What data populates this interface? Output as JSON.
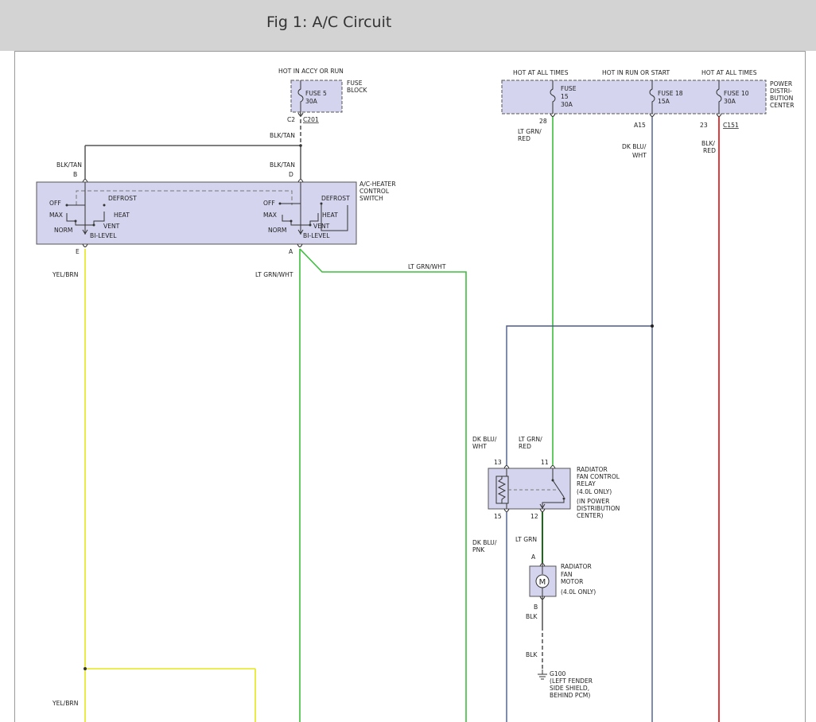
{
  "header": {
    "title": "Fig 1: A/C Circuit"
  },
  "fuse_block": {
    "hot_label": "HOT IN ACCY OR RUN",
    "fuse_name": "FUSE 5",
    "fuse_rating": "30A",
    "label_1": "FUSE",
    "label_2": "BLOCK",
    "conn_pin": "C2",
    "conn_name": "C201"
  },
  "pdc": {
    "hot1": "HOT AT ALL TIMES",
    "hot2": "HOT IN RUN OR START",
    "hot3": "HOT AT ALL TIMES",
    "fuse15_a": "FUSE",
    "fuse15_b": "15",
    "fuse15_c": "30A",
    "fuse18_a": "FUSE 18",
    "fuse18_b": "15A",
    "fuse10_a": "FUSE 10",
    "fuse10_b": "30A",
    "label_1": "POWER",
    "label_2": "DISTRI-",
    "label_3": "BUTION",
    "label_4": "CENTER",
    "pin28": "28",
    "pinA15": "A15",
    "pin23": "23",
    "conn": "C151"
  },
  "wires": {
    "blk_tan_top": "BLK/TAN",
    "blk_tan_b": "BLK/TAN",
    "blk_tan_d": "BLK/TAN",
    "yel_brn": "YEL/BRN",
    "lt_grn_wht_left": "LT GRN/WHT",
    "lt_grn_wht_right": "LT GRN/WHT",
    "lt_grn_red_1": "LT GRN/",
    "lt_grn_red_2": "RED",
    "dk_blu_wht_1": "DK BLU/",
    "dk_blu_wht_2": "WHT",
    "blk_red_1": "BLK/",
    "blk_red_2": "RED",
    "relay_left_1": "DK BLU/",
    "relay_left_2": "WHT",
    "relay_right_1": "LT GRN/",
    "relay_right_2": "RED",
    "dk_blu_pnk_1": "DK BLU/",
    "dk_blu_pnk_2": "PNK",
    "lt_grn": "LT GRN",
    "blk_1": "BLK",
    "blk_2": "BLK",
    "yel_brn_bottom": "YEL/BRN"
  },
  "switch": {
    "pin_b": "B",
    "pin_d": "D",
    "pin_e": "E",
    "pin_a": "A",
    "label_1": "A/C-HEATER",
    "label_2": "CONTROL",
    "label_3": "SWITCH",
    "off_l": "OFF",
    "defrost_l": "DEFROST",
    "max_l": "MAX",
    "heat_l": "HEAT",
    "norm_l": "NORM",
    "vent_l": "VENT",
    "bilevel_l": "BI-LEVEL",
    "off_r": "OFF",
    "defrost_r": "DEFROST",
    "max_r": "MAX",
    "heat_r": "HEAT",
    "norm_r": "NORM",
    "vent_r": "VENT",
    "bilevel_r": "BI-LEVEL"
  },
  "relay": {
    "pin13": "13",
    "pin11": "11",
    "pin15": "15",
    "pin12": "12",
    "label_1": "RADIATOR",
    "label_2": "FAN CONTROL",
    "label_3": "RELAY",
    "label_4": "(4.0L ONLY)",
    "label_5": "(IN POWER",
    "label_6": "DISTRIBUTION",
    "label_7": "CENTER)"
  },
  "motor": {
    "pin_a": "A",
    "pin_b": "B",
    "symbol": "M",
    "label_1": "RADIATOR",
    "label_2": "FAN",
    "label_3": "MOTOR",
    "label_4": "(4.0L ONLY)"
  },
  "ground": {
    "name": "G100",
    "label_1": "(LEFT FENDER",
    "label_2": "SIDE SHIELD,",
    "label_3": "BEHIND PCM)"
  },
  "colors": {
    "green_wire": "#3dbe3d",
    "yellow_wire": "#e6e61a",
    "blue_wire": "#4a5a8a",
    "red_wire": "#e01818",
    "dark_green_wire": "#1a6a1a",
    "component_fill": "#d4d4ee"
  }
}
